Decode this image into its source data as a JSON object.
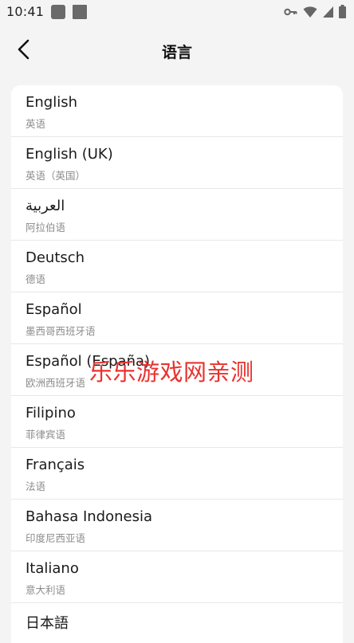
{
  "status_bar": {
    "time": "10:41",
    "icons": [
      "app-notification-icon",
      "app-notification-icon",
      "vpn-key-icon",
      "wifi-icon",
      "cellular-signal-icon",
      "battery-icon"
    ]
  },
  "header": {
    "title": "语言",
    "back_icon": "chevron-left-icon"
  },
  "languages": [
    {
      "name": "English",
      "native": "英语"
    },
    {
      "name": "English (UK)",
      "native": "英语（英国）"
    },
    {
      "name": "العربية",
      "native": "阿拉伯语"
    },
    {
      "name": "Deutsch",
      "native": "德语"
    },
    {
      "name": "Español",
      "native": "墨西哥西班牙语"
    },
    {
      "name": "Español (España)",
      "native": "欧洲西班牙语"
    },
    {
      "name": "Filipino",
      "native": "菲律宾语"
    },
    {
      "name": "Français",
      "native": "法语"
    },
    {
      "name": "Bahasa Indonesia",
      "native": "印度尼西亚语"
    },
    {
      "name": "Italiano",
      "native": "意大利语"
    },
    {
      "name": "日本語",
      "native": ""
    }
  ],
  "watermark": "乐乐游戏网亲测",
  "colors": {
    "background": "#f4f4f4",
    "card": "#ffffff",
    "watermark": "#e8322e",
    "secondary_text": "#8c8c8c"
  }
}
